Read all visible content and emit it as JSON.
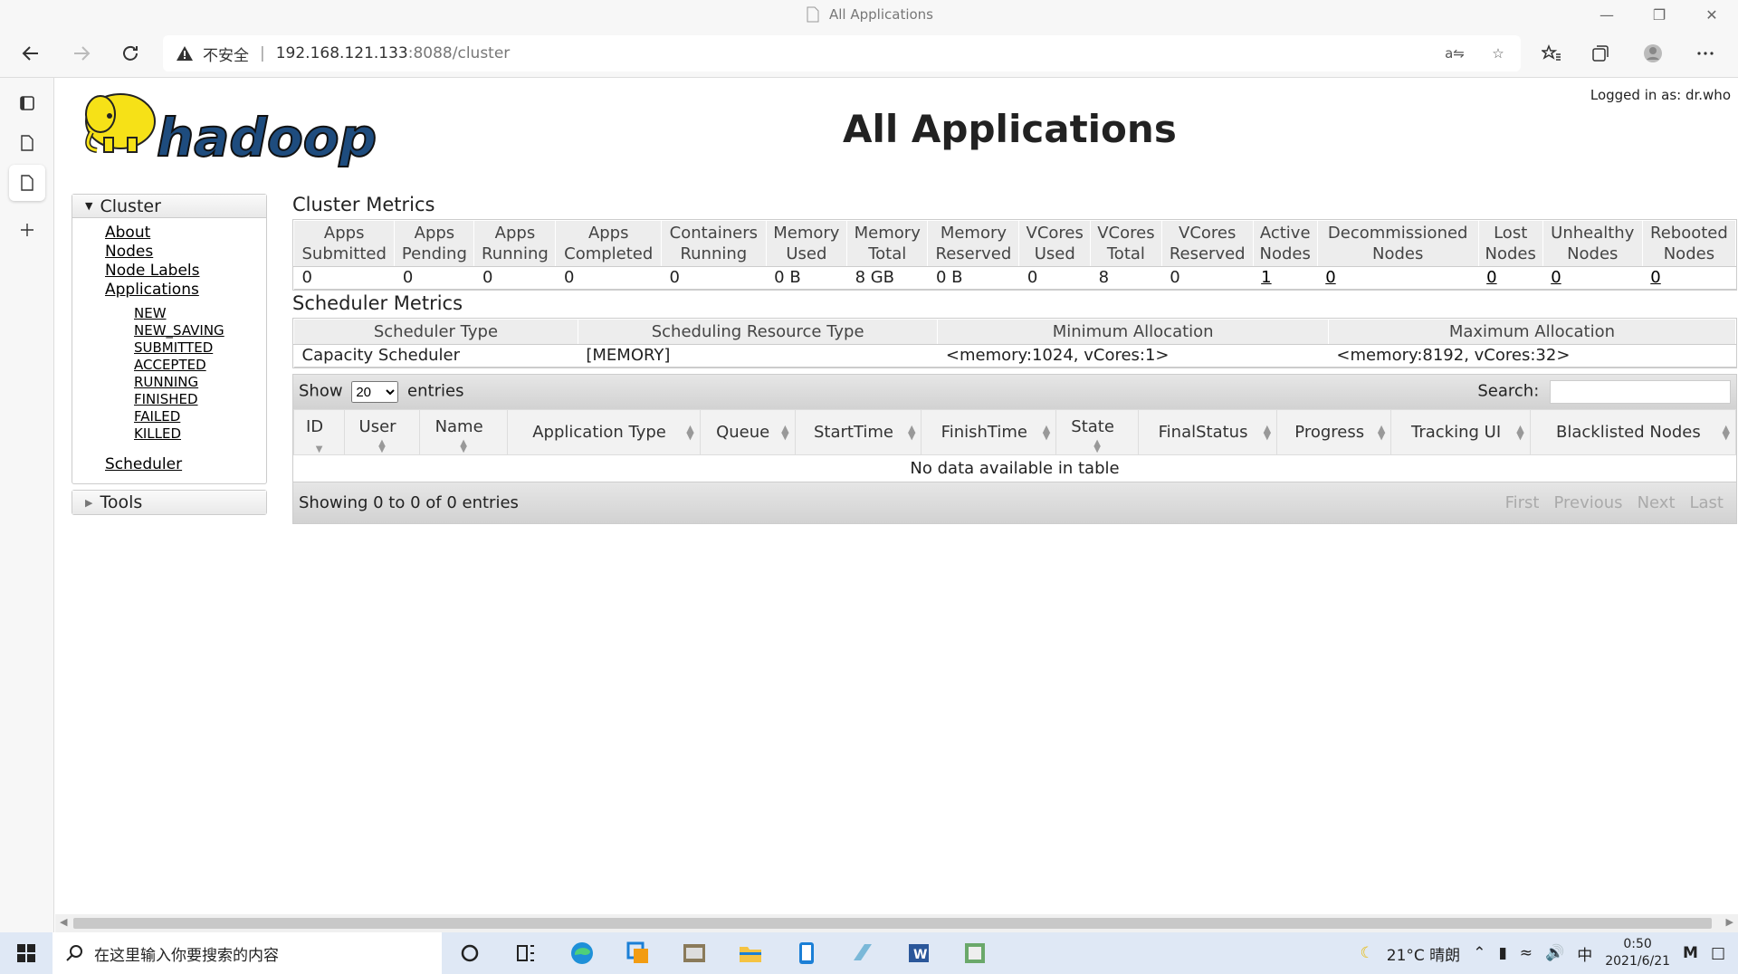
{
  "window": {
    "title": "All Applications"
  },
  "address_bar": {
    "security_label": "不安全",
    "separator": "|",
    "url_host": "192.168.121.133",
    "url_rest": ":8088/cluster"
  },
  "page": {
    "logged_in": "Logged in as: dr.who",
    "title": "All Applications",
    "logo_text": "hadoop"
  },
  "nav": {
    "cluster_label": "Cluster",
    "links": [
      "About",
      "Nodes",
      "Node Labels",
      "Applications"
    ],
    "app_states": [
      "NEW",
      "NEW_SAVING",
      "SUBMITTED",
      "ACCEPTED",
      "RUNNING",
      "FINISHED",
      "FAILED",
      "KILLED"
    ],
    "scheduler_label": "Scheduler",
    "tools_label": "Tools"
  },
  "cluster_metrics": {
    "title": "Cluster Metrics",
    "headers": [
      [
        "Apps",
        "Submitted"
      ],
      [
        "Apps",
        "Pending"
      ],
      [
        "Apps",
        "Running"
      ],
      [
        "Apps",
        "Completed"
      ],
      [
        "Containers",
        "Running"
      ],
      [
        "Memory",
        "Used"
      ],
      [
        "Memory",
        "Total"
      ],
      [
        "Memory",
        "Reserved"
      ],
      [
        "VCores",
        "Used"
      ],
      [
        "VCores",
        "Total"
      ],
      [
        "VCores",
        "Reserved"
      ],
      [
        "Active",
        "Nodes"
      ],
      [
        "Decommissioned",
        "Nodes"
      ],
      [
        "Lost",
        "Nodes"
      ],
      [
        "Unhealthy",
        "Nodes"
      ],
      [
        "Rebooted",
        "Nodes"
      ]
    ],
    "values": [
      "0",
      "0",
      "0",
      "0",
      "0",
      "0 B",
      "8 GB",
      "0 B",
      "0",
      "8",
      "0",
      "1",
      "0",
      "0",
      "0",
      "0"
    ]
  },
  "scheduler_metrics": {
    "title": "Scheduler Metrics",
    "headers": [
      "Scheduler Type",
      "Scheduling Resource Type",
      "Minimum Allocation",
      "Maximum Allocation"
    ],
    "values": [
      "Capacity Scheduler",
      "[MEMORY]",
      "<memory:1024, vCores:1>",
      "<memory:8192, vCores:32>"
    ]
  },
  "apps_table": {
    "show_label": "Show",
    "entries_value": "20",
    "entries_label": "entries",
    "search_label": "Search:",
    "columns": [
      "ID",
      "User",
      "Name",
      "Application Type",
      "Queue",
      "StartTime",
      "FinishTime",
      "State",
      "FinalStatus",
      "Progress",
      "Tracking UI",
      "Blacklisted Nodes"
    ],
    "empty_text": "No data available in table",
    "info": "Showing 0 to 0 of 0 entries",
    "pager": [
      "First",
      "Previous",
      "Next",
      "Last"
    ]
  },
  "taskbar": {
    "search_placeholder": "在这里输入你要搜索的内容",
    "weather": "21°C  晴朗",
    "ime": "中",
    "time": "0:50",
    "date": "2021/6/21"
  }
}
